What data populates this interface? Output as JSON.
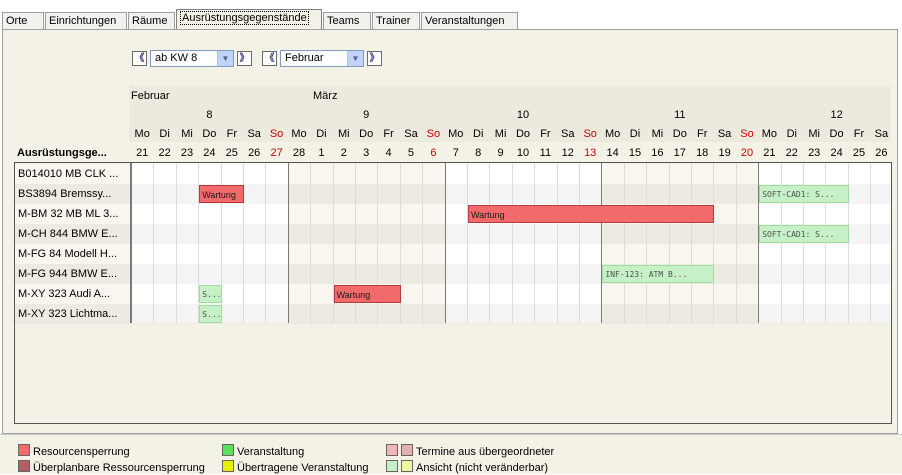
{
  "tabs": [
    "Orte",
    "Einrichtungen",
    "Räume",
    "Ausrüstungsgegenstände",
    "Teams",
    "Trainer",
    "Veranstaltungen"
  ],
  "active_tab": "Ausrüstungsgegenstände",
  "controls": {
    "prev_week": "《",
    "week_select": "ab KW 8",
    "next_week": "》",
    "prev_month": "《",
    "month_select": "Februar",
    "next_month": "》"
  },
  "header": {
    "months": [
      "Februar",
      "März"
    ],
    "weeks": [
      "8",
      "9",
      "10",
      "11",
      "12"
    ],
    "weekdays": [
      "Mo",
      "Di",
      "Mi",
      "Do",
      "Fr",
      "Sa",
      "So",
      "Mo",
      "Di",
      "Mi",
      "Do",
      "Fr",
      "Sa",
      "So",
      "Mo",
      "Di",
      "Mi",
      "Do",
      "Fr",
      "Sa",
      "So",
      "Mo",
      "Di",
      "Mi",
      "Do",
      "Fr",
      "Sa",
      "So",
      "Mo",
      "Di",
      "Mi",
      "Do",
      "Fr",
      "Sa"
    ],
    "dates": [
      "21",
      "22",
      "23",
      "24",
      "25",
      "26",
      "27",
      "28",
      "1",
      "2",
      "3",
      "4",
      "5",
      "6",
      "7",
      "8",
      "9",
      "10",
      "11",
      "12",
      "13",
      "14",
      "15",
      "16",
      "17",
      "18",
      "19",
      "20",
      "21",
      "22",
      "23",
      "24",
      "25",
      "26"
    ],
    "column_title": "Ausrüstungsge..."
  },
  "rows": [
    "B014010 MB CLK ...",
    "BS3894 Bremssy...",
    "M-BM 32 MB ML 3...",
    "M-CH 844 BMW E...",
    "M-FG 84 Modell H...",
    "M-FG 944 BMW E...",
    "M-XY 323 Audi A...",
    "M-XY 323 Lichtma..."
  ],
  "events": [
    {
      "row": 1,
      "start": 3,
      "end": 5,
      "type": "block",
      "label": "Wartung"
    },
    {
      "row": 1,
      "start": 28,
      "end": 32,
      "type": "green",
      "label": "SOFT-CAD1: S..."
    },
    {
      "row": 2,
      "start": 15,
      "end": 26,
      "type": "block",
      "label": "Wartung"
    },
    {
      "row": 3,
      "start": 28,
      "end": 32,
      "type": "green",
      "label": "SOFT-CAD1: S..."
    },
    {
      "row": 5,
      "start": 21,
      "end": 26,
      "type": "green",
      "label": "INF-123: ATM B..."
    },
    {
      "row": 6,
      "start": 3,
      "end": 4,
      "type": "green",
      "label": "S..."
    },
    {
      "row": 6,
      "start": 9,
      "end": 12,
      "type": "block",
      "label": "Wartung"
    },
    {
      "row": 7,
      "start": 3,
      "end": 4,
      "type": "green",
      "label": "S..."
    }
  ],
  "legend": [
    {
      "label": "Resourcensperrung",
      "colors": [
        "#f26a6a"
      ]
    },
    {
      "label": "Veranstaltung",
      "colors": [
        "#5ce05c"
      ]
    },
    {
      "label": "Termine aus übergeordneter",
      "colors": [
        "#f3b6b6",
        "#e5b0b0"
      ]
    },
    {
      "label": "Überplanbare Ressourcensperrung",
      "colors": [
        "#b06060"
      ]
    },
    {
      "label": "Übertragene Veranstaltung",
      "colors": [
        "#e8f000"
      ]
    },
    {
      "label": "Ansicht (nicht veränderbar)",
      "colors": [
        "#c6f0c6",
        "#eef8a0"
      ]
    }
  ]
}
